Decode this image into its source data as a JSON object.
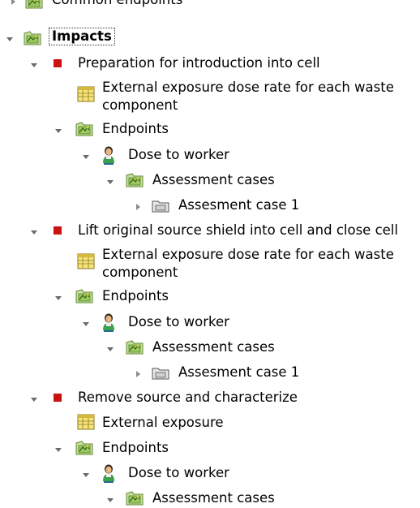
{
  "tree": {
    "common_endpoints": "Common endpoints",
    "impacts": "Impacts",
    "steps": [
      {
        "title": "Preparation for  introduction into cell",
        "dose_rate": "External exposure dose rate for each waste component",
        "endpoints": "Endpoints",
        "dose": "Dose to worker",
        "assessment_cases": "Assessment cases",
        "case": "Assesment case 1"
      },
      {
        "title": "Lift original source shield into cell and close cell",
        "dose_rate": "External exposure dose rate for each waste component",
        "endpoints": "Endpoints",
        "dose": "Dose to worker",
        "assessment_cases": "Assessment cases",
        "case": "Assesment case 1"
      },
      {
        "title": "Remove source and characterize",
        "dose_rate": "External exposure",
        "endpoints": "Endpoints",
        "dose": "Dose to worker",
        "assessment_cases": "Assessment cases"
      }
    ]
  },
  "icons": {
    "folder_map": "folder-map-icon",
    "red_square": "activity-icon",
    "table": "table-icon",
    "person": "person-icon",
    "folder": "folder-icon"
  },
  "colors": {
    "red_marker": "#cc1111",
    "folder_green": "#8fbf4a",
    "table_yellow": "#f4e27a"
  }
}
